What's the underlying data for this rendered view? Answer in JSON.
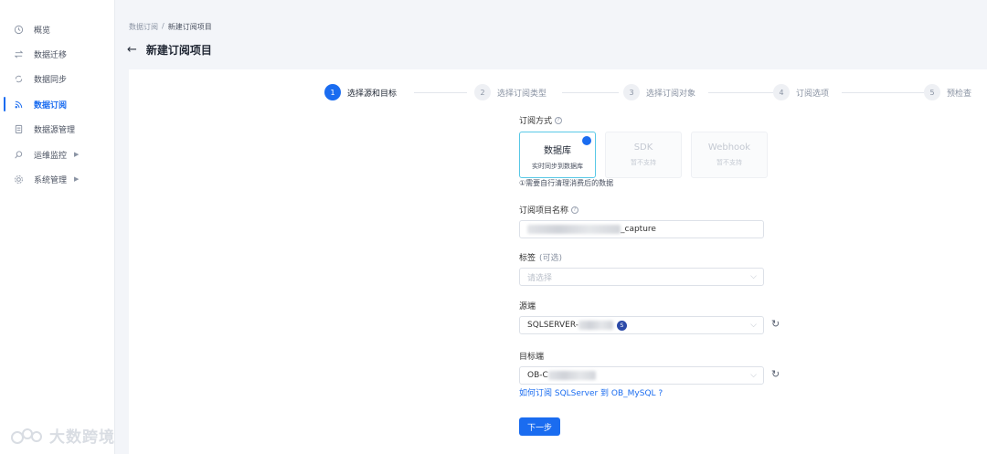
{
  "sidebar": {
    "items": [
      {
        "label": "概览",
        "icon": "clock-icon"
      },
      {
        "label": "数据迁移",
        "icon": "transfer-icon"
      },
      {
        "label": "数据同步",
        "icon": "sync-icon"
      },
      {
        "label": "数据订阅",
        "icon": "subscribe-icon",
        "active": true
      },
      {
        "label": "数据源管理",
        "icon": "datasource-icon"
      },
      {
        "label": "运维监控",
        "icon": "monitor-icon",
        "expandable": true
      },
      {
        "label": "系统管理",
        "icon": "settings-icon",
        "expandable": true
      }
    ]
  },
  "header": {
    "breadcrumb": [
      "数据订阅",
      "新建订阅项目"
    ],
    "breadcrumb_sep": "/",
    "title": "新建订阅项目"
  },
  "steps": [
    {
      "num": "1",
      "label": "选择源和目标",
      "active": true
    },
    {
      "num": "2",
      "label": "选择订阅类型"
    },
    {
      "num": "3",
      "label": "选择订阅对象"
    },
    {
      "num": "4",
      "label": "订阅选项"
    },
    {
      "num": "5",
      "label": "预检查"
    }
  ],
  "form": {
    "mode_label": "订阅方式",
    "modes": [
      {
        "title": "数据库",
        "sub": "实时同步到数据库",
        "selected": true
      },
      {
        "title": "SDK",
        "sub": "暂不支持"
      },
      {
        "title": "Webhook",
        "sub": "暂不支持"
      }
    ],
    "notice": "①需要自行清理消费后的数据",
    "name_label": "订阅项目名称",
    "name_value_suffix": "_capture",
    "tag_label": "标签",
    "tag_optional": "(可选)",
    "tag_placeholder": "请选择",
    "source_label": "源端",
    "source_value": "SQLSERVER-",
    "source_badge": "S",
    "target_label": "目标端",
    "target_value": "OB-C",
    "help_link": "如何订阅 SQLServer 到 OB_MySQL ?",
    "next_label": "下一步"
  },
  "watermark": {
    "text": "大数跨境"
  },
  "colors": {
    "accent": "#1a6cf0",
    "card_border": "#58c8e6",
    "badge": "#2c4aa8"
  }
}
